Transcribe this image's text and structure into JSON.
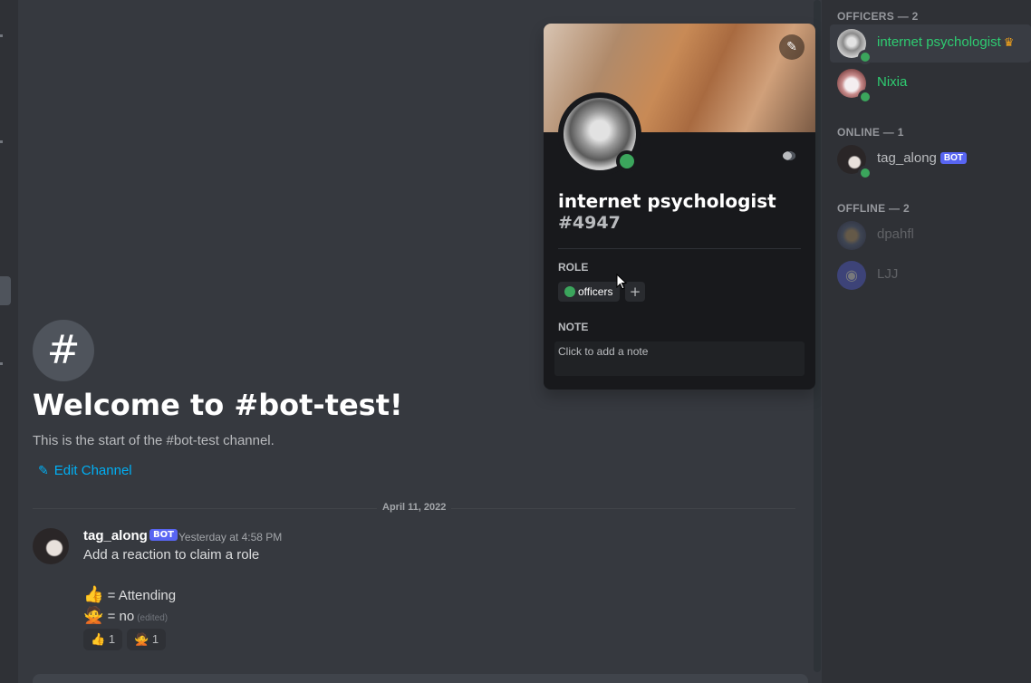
{
  "channel": {
    "welcome_icon": "#",
    "welcome_title": "Welcome to #bot-test!",
    "welcome_subtitle": "This is the start of the #bot-test channel.",
    "edit_channel_label": "Edit Channel"
  },
  "date_divider": "April 11, 2022",
  "message": {
    "author": "tag_along",
    "bot_tag": "BOT",
    "timestamp": "Yesterday at 4:58 PM",
    "line1": "Add a reaction to claim a role",
    "line2_emoji": "👍",
    "line2_text": "= Attending",
    "line3_emoji": "🙅",
    "line3_text": "= no",
    "edited": "(edited)",
    "reactions": [
      {
        "emoji": "👍",
        "count": "1"
      },
      {
        "emoji": "🙅",
        "count": "1"
      }
    ]
  },
  "popout": {
    "username": "internet psychologist",
    "discriminator": "#4947",
    "role_label": "ROLE",
    "role_name": "officers",
    "role_add": "+",
    "note_label": "NOTE",
    "note_placeholder": "Click to add a note"
  },
  "members": {
    "officers_header": "OFFICERS — 2",
    "online_header": "ONLINE — 1",
    "offline_header": "OFFLINE — 2",
    "officers": [
      {
        "name": "internet psychologist",
        "color": "#2ecc71"
      },
      {
        "name": "Nixia",
        "color": "#2ecc71"
      }
    ],
    "online": [
      {
        "name": "tag_along",
        "bot_tag": "BOT"
      }
    ],
    "offline": [
      {
        "name": "dpahfl"
      },
      {
        "name": "LJJ"
      }
    ]
  },
  "colors": {
    "accent_link": "#00aff4",
    "online": "#3ba55c",
    "role_officers": "#2ecc71",
    "bot_tag": "#5865f2"
  }
}
